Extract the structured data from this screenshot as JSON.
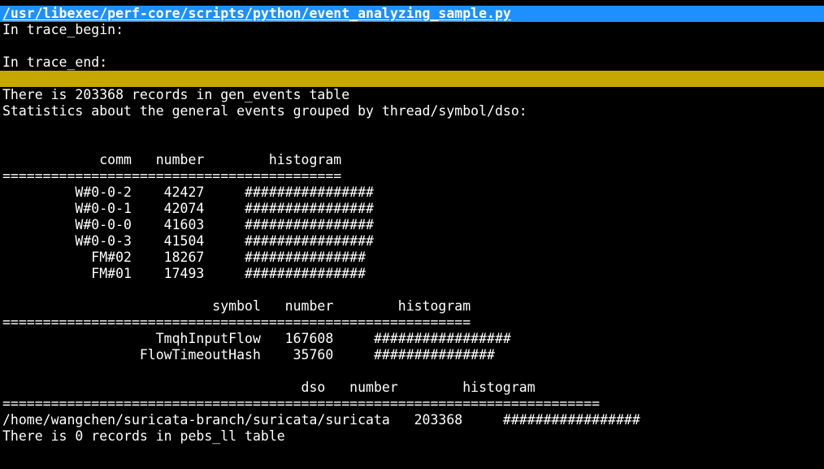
{
  "terminal": {
    "title_path": "/usr/libexec/perf-core/scripts/python/event_analyzing_sample.py",
    "accent_color": "#1e8fff",
    "highlight_color": "#c6a700",
    "lines": [
      "In trace_begin:",
      "",
      "In trace_end:",
      "",
      "There is 203368 records in gen_events table",
      "Statistics about the general events grouped by thread/symbol/dso:",
      "",
      "",
      "            comm   number        histogram",
      "==========================================",
      "         W#0-0-2    42427     ################",
      "         W#0-0-1    42074     ################",
      "         W#0-0-0    41603     ################",
      "         W#0-0-3    41504     ################",
      "           FM#02    18267     ###############",
      "           FM#01    17493     ###############",
      "",
      "                          symbol   number        histogram",
      "==========================================================",
      "                   TmqhInputFlow   167608     #################",
      "                 FlowTimeoutHash    35760     ###############",
      "",
      "                                     dso   number        histogram",
      "==========================================================================",
      "/home/wangchen/suricata-branch/suricata/suricata   203368     #################",
      "There is 0 records in pebs_ll table"
    ]
  }
}
